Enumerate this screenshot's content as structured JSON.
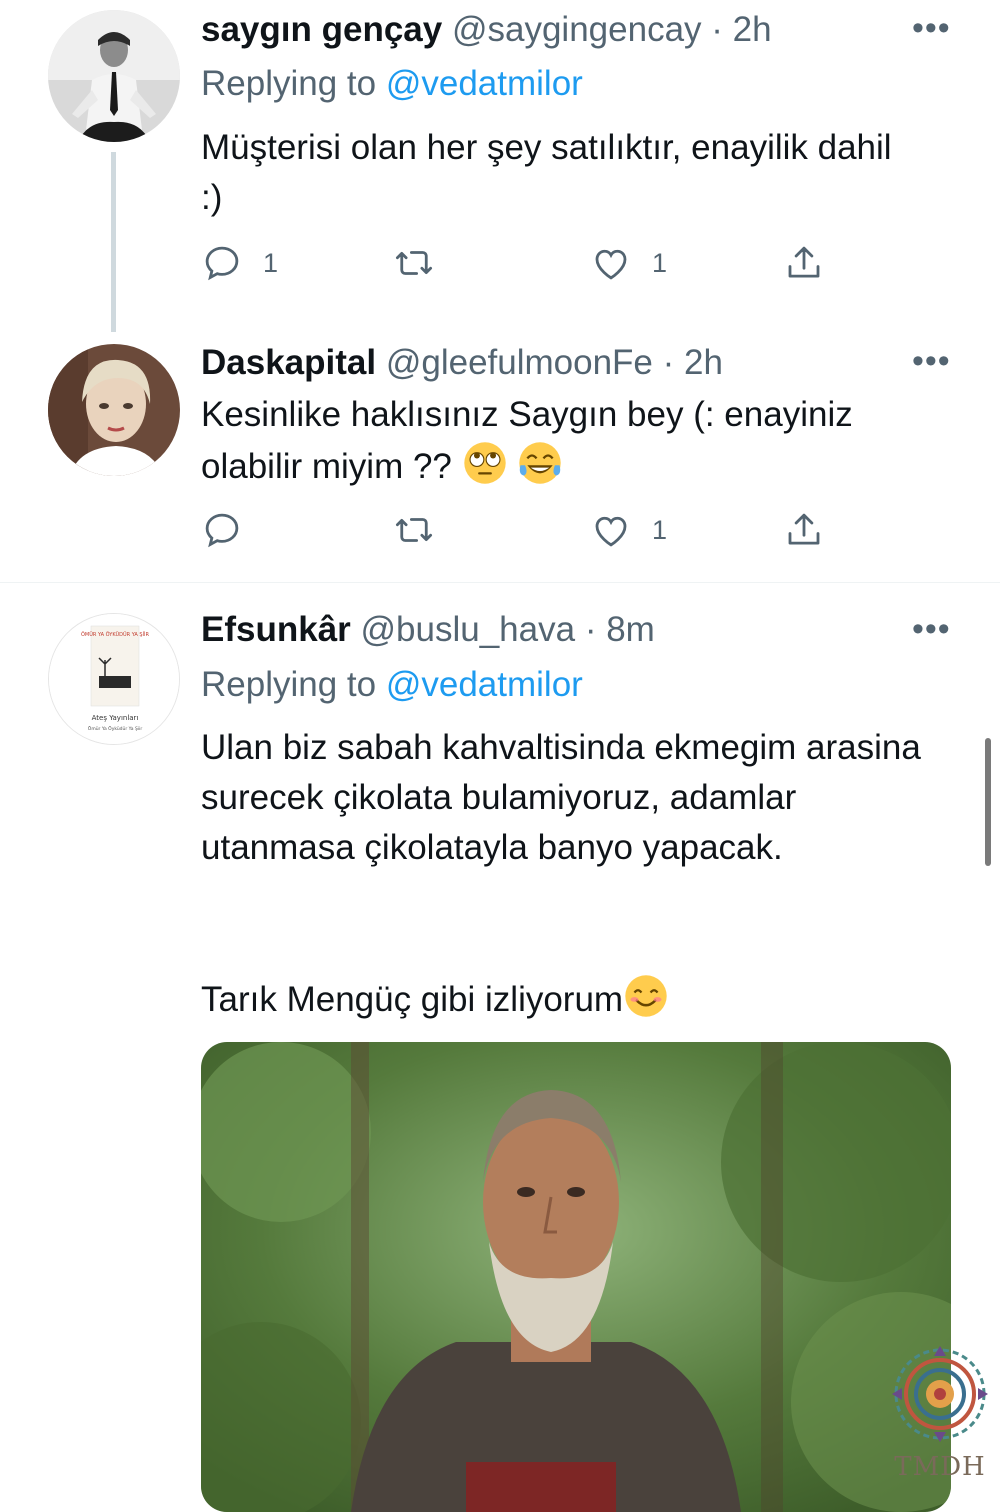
{
  "tweets": [
    {
      "name": "saygın gençay",
      "handle": "@saygingencay",
      "separator": "·",
      "time": "2h",
      "replying_prefix": "Replying to",
      "replying_to": "@vedatmilor",
      "text": "Müşterisi olan her şey satılıktır, enayilik dahil :)",
      "reply_count": "1",
      "retweet_count": "",
      "like_count": "1"
    },
    {
      "name": "Daskapital",
      "handle": "@gleefulmoonFe",
      "separator": "·",
      "time": "2h",
      "text": "Kesinlike haklısınız Saygın bey (: enayiniz olabilir miyim ??",
      "reply_count": "",
      "retweet_count": "",
      "like_count": "1"
    },
    {
      "name": "Efsunkâr",
      "handle": "@buslu_hava",
      "separator": "·",
      "time": "8m",
      "replying_prefix": "Replying to",
      "replying_to": "@vedatmilor",
      "text_line1": "Ulan biz sabah kahvaltisinda ekmegim arasina surecek çikolata bulamiyoruz, adamlar utanmasa çikolatayla banyo yapacak.",
      "text_line2": "Tarık Mengüç gibi izliyorum",
      "avatar_book_title": "ÖMÜR YA ÖYKÜDÜR YA ŞİİR",
      "avatar_publisher": "Ateş Yayınları",
      "avatar_subtitle": "Ömür Ya Öyküdür Ya Şiir"
    }
  ],
  "more_glyph": "•••",
  "watermark": "TMDH",
  "icons": [
    "reply-icon",
    "retweet-icon",
    "like-icon",
    "share-icon",
    "more-icon"
  ],
  "colors": {
    "link": "#1d9bf0",
    "secondary": "#536471",
    "text": "#0f1419",
    "divider": "#eff3f4"
  }
}
